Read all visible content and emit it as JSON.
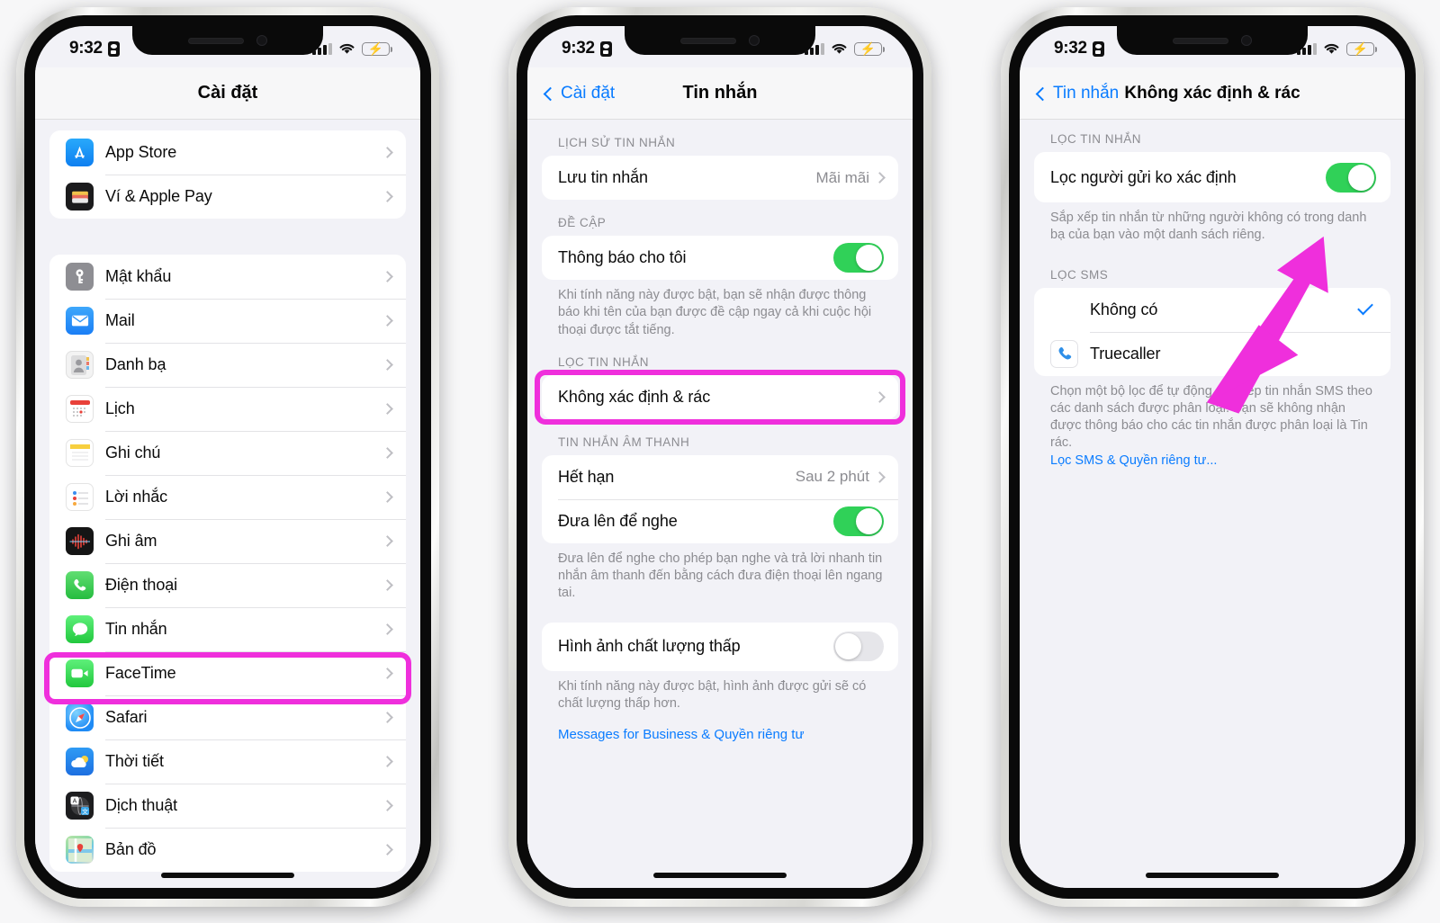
{
  "status_bar": {
    "time": "9:32",
    "lock_icon": "lock-portrait-icon",
    "signal_icon": "cellular-signal-icon",
    "wifi_icon": "wifi-icon",
    "battery_icon": "battery-charging-icon"
  },
  "phone1": {
    "nav": {
      "title": "Cài đặt",
      "back_label": ""
    },
    "groups": [
      {
        "header": "",
        "rows": [
          {
            "icon": "app-store-icon",
            "icon_class": "ic-appstore",
            "label": "App Store",
            "accessory": "chevron"
          },
          {
            "icon": "wallet-icon",
            "icon_class": "ic-wallet",
            "label": "Ví & Apple Pay",
            "accessory": "chevron"
          }
        ]
      },
      {
        "header": "",
        "rows": [
          {
            "icon": "passwords-key-icon",
            "icon_class": "ic-pass",
            "label": "Mật khẩu",
            "accessory": "chevron"
          },
          {
            "icon": "mail-icon",
            "icon_class": "ic-mail",
            "label": "Mail",
            "accessory": "chevron"
          },
          {
            "icon": "contacts-icon",
            "icon_class": "ic-contacts",
            "label": "Danh bạ",
            "accessory": "chevron"
          },
          {
            "icon": "calendar-icon",
            "icon_class": "ic-cal",
            "label": "Lịch",
            "accessory": "chevron"
          },
          {
            "icon": "notes-icon",
            "icon_class": "ic-notes",
            "label": "Ghi chú",
            "accessory": "chevron"
          },
          {
            "icon": "reminders-icon",
            "icon_class": "ic-remind",
            "label": "Lời nhắc",
            "accessory": "chevron"
          },
          {
            "icon": "voice-memos-icon",
            "icon_class": "ic-voice",
            "label": "Ghi âm",
            "accessory": "chevron"
          },
          {
            "icon": "phone-icon",
            "icon_class": "ic-phone",
            "label": "Điện thoại",
            "accessory": "chevron"
          },
          {
            "icon": "messages-icon",
            "icon_class": "ic-msg",
            "label": "Tin nhắn",
            "accessory": "chevron",
            "highlighted": true
          },
          {
            "icon": "facetime-icon",
            "icon_class": "ic-ft",
            "label": "FaceTime",
            "accessory": "chevron"
          },
          {
            "icon": "safari-icon",
            "icon_class": "ic-safari",
            "label": "Safari",
            "accessory": "chevron"
          },
          {
            "icon": "weather-icon",
            "icon_class": "ic-weather",
            "label": "Thời tiết",
            "accessory": "chevron"
          },
          {
            "icon": "translate-icon",
            "icon_class": "ic-translate",
            "label": "Dịch thuật",
            "accessory": "chevron"
          },
          {
            "icon": "maps-icon",
            "icon_class": "ic-maps",
            "label": "Bản đồ",
            "accessory": "chevron"
          }
        ]
      }
    ]
  },
  "phone2": {
    "nav": {
      "back_label": "Cài đặt",
      "title": "Tin nhắn"
    },
    "sections": [
      {
        "header": "LỊCH SỬ TIN NHẮN",
        "rows": [
          {
            "label": "Lưu tin nhắn",
            "value": "Mãi mãi",
            "accessory": "chevron"
          }
        ],
        "footer": ""
      },
      {
        "header": "ĐỀ CẬP",
        "rows": [
          {
            "label": "Thông báo cho tôi",
            "accessory": "toggle",
            "toggle_on": true
          }
        ],
        "footer": "Khi tính năng này được bật, bạn sẽ nhận được thông báo khi tên của bạn được đề cập ngay cả khi cuộc hội thoại được tắt tiếng."
      },
      {
        "header": "LỌC TIN NHẮN",
        "rows": [
          {
            "label": "Không xác định & rác",
            "accessory": "chevron",
            "highlighted": true
          }
        ],
        "footer": ""
      },
      {
        "header": "TIN NHẮN ÂM THANH",
        "rows": [
          {
            "label": "Hết hạn",
            "value": "Sau 2 phút",
            "accessory": "chevron"
          },
          {
            "label": "Đưa lên để nghe",
            "accessory": "toggle",
            "toggle_on": true
          }
        ],
        "footer": "Đưa lên để nghe cho phép bạn nghe và trả lời nhanh tin nhắn âm thanh đến bằng cách đưa điện thoại lên ngang tai."
      },
      {
        "header": "",
        "rows": [
          {
            "label": "Hình ảnh chất lượng thấp",
            "accessory": "toggle",
            "toggle_on": false
          }
        ],
        "footer": "Khi tính năng này được bật, hình ảnh được gửi sẽ có chất lượng thấp hơn."
      }
    ],
    "bottom_link": "Messages for Business & Quyền riêng tư"
  },
  "phone3": {
    "nav": {
      "back_label": "Tin nhắn",
      "title": "Không xác định & rác"
    },
    "sections": [
      {
        "header": "LỌC TIN NHẮN",
        "rows": [
          {
            "label": "Lọc người gửi ko xác định",
            "accessory": "toggle",
            "toggle_on": true,
            "arrow_pointer": true
          }
        ],
        "footer": "Sắp xếp tin nhắn từ những người không có trong danh bạ của bạn vào một danh sách riêng."
      },
      {
        "header": "LỌC SMS",
        "rows": [
          {
            "label": "Không có",
            "accessory": "check",
            "selected": true,
            "indent": true
          },
          {
            "icon": "truecaller-phone-icon",
            "icon_class": "ic-true",
            "label": "Truecaller",
            "accessory": "none"
          }
        ],
        "footer": "Chọn một bộ lọc để tự động sắp xếp tin nhắn SMS theo các danh sách được phân loại. Bạn sẽ không nhận được thông báo cho các tin nhắn được phân loại là Tin rác.",
        "footer_link": "Lọc SMS & Quyền riêng tư..."
      }
    ]
  },
  "annotation": {
    "highlight_color": "#ef2fdc",
    "arrow_color": "#ef2fdc",
    "arrow_name": "pointer-arrow"
  }
}
